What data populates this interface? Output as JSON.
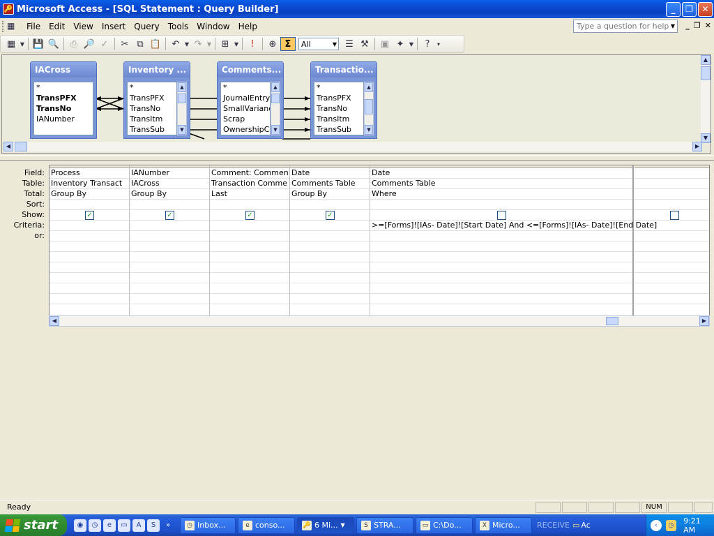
{
  "window": {
    "title": "Microsoft Access - [SQL Statement : Query Builder]"
  },
  "menu": {
    "items": [
      "File",
      "Edit",
      "View",
      "Insert",
      "Query",
      "Tools",
      "Window",
      "Help"
    ],
    "help_placeholder": "Type a question for help"
  },
  "toolbar": {
    "top_values": "All"
  },
  "tables": [
    {
      "name": "IACross",
      "fields": [
        "*",
        "TransPFX",
        "TransNo",
        "IANumber"
      ],
      "bold": [
        false,
        true,
        true,
        false
      ]
    },
    {
      "name": "Inventory ...",
      "fields": [
        "*",
        "TransPFX",
        "TransNo",
        "TransItm",
        "TransSub"
      ]
    },
    {
      "name": "Comments...",
      "fields": [
        "*",
        "JournalEntry",
        "SmallVariance",
        "Scrap",
        "OwnershipCh"
      ]
    },
    {
      "name": "Transactio...",
      "fields": [
        "*",
        "TransPFX",
        "TransNo",
        "TransItm",
        "TransSub"
      ]
    }
  ],
  "grid": {
    "row_labels": [
      "Field:",
      "Table:",
      "Total:",
      "Sort:",
      "Show:",
      "Criteria:",
      "or:"
    ],
    "columns": [
      {
        "field": "Process",
        "table": "Inventory Transact",
        "total": "Group By",
        "sort": "",
        "show": true,
        "criteria": ""
      },
      {
        "field": "IANumber",
        "table": "IACross",
        "total": "Group By",
        "sort": "",
        "show": true,
        "criteria": ""
      },
      {
        "field": "Comment: Commen",
        "table": "Transaction Comme",
        "total": "Last",
        "sort": "",
        "show": true,
        "criteria": ""
      },
      {
        "field": "Date",
        "table": "Comments Table",
        "total": "Group By",
        "sort": "",
        "show": true,
        "criteria": ""
      },
      {
        "field": "Date",
        "table": "Comments Table",
        "total": "Where",
        "sort": "",
        "show": false,
        "criteria": ">=[Forms]![IAs- Date]![Start Date] And <=[Forms]![IAs- Date]![End Date]"
      },
      {
        "field": "",
        "table": "",
        "total": "",
        "sort": "",
        "show": false,
        "criteria": ""
      }
    ]
  },
  "status": {
    "text": "Ready",
    "num": "NUM"
  },
  "taskbar": {
    "start_label": "start",
    "buttons": [
      "Inbox...",
      "conso...",
      "6 Mi...",
      "STRA...",
      "C:\\Do...",
      "Micro..."
    ],
    "receive_label": "RECEIVE",
    "ac_label": "Ac",
    "clock": "9:21 AM"
  }
}
